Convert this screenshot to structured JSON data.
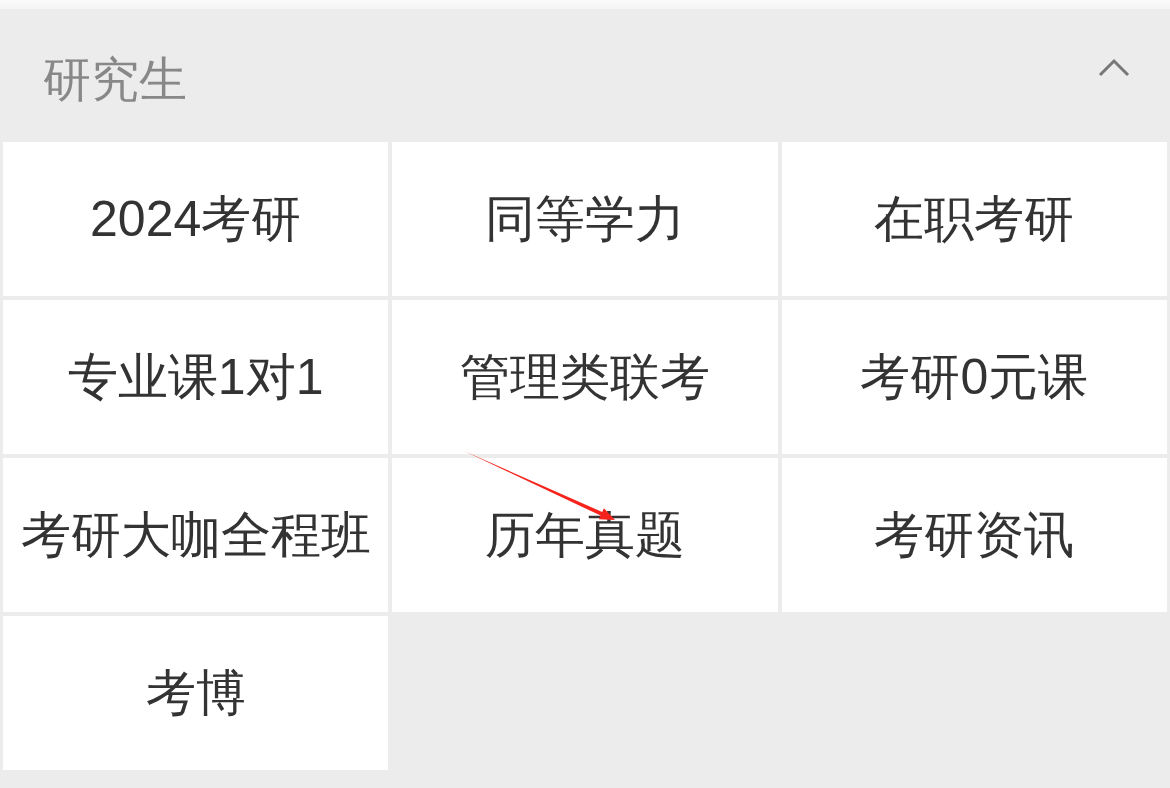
{
  "section": {
    "title": "研究生",
    "expanded": true,
    "items": [
      {
        "label": "2024考研",
        "marked": false
      },
      {
        "label": "同等学力",
        "marked": false
      },
      {
        "label": "在职考研",
        "marked": false
      },
      {
        "label": "专业课1对1",
        "marked": false
      },
      {
        "label": "管理类联考",
        "marked": false
      },
      {
        "label": "考研0元课",
        "marked": false
      },
      {
        "label": "考研大咖全程班",
        "marked": false
      },
      {
        "label": "历年真题",
        "marked": true
      },
      {
        "label": "考研资讯",
        "marked": false
      },
      {
        "label": "考博",
        "marked": false
      }
    ]
  }
}
